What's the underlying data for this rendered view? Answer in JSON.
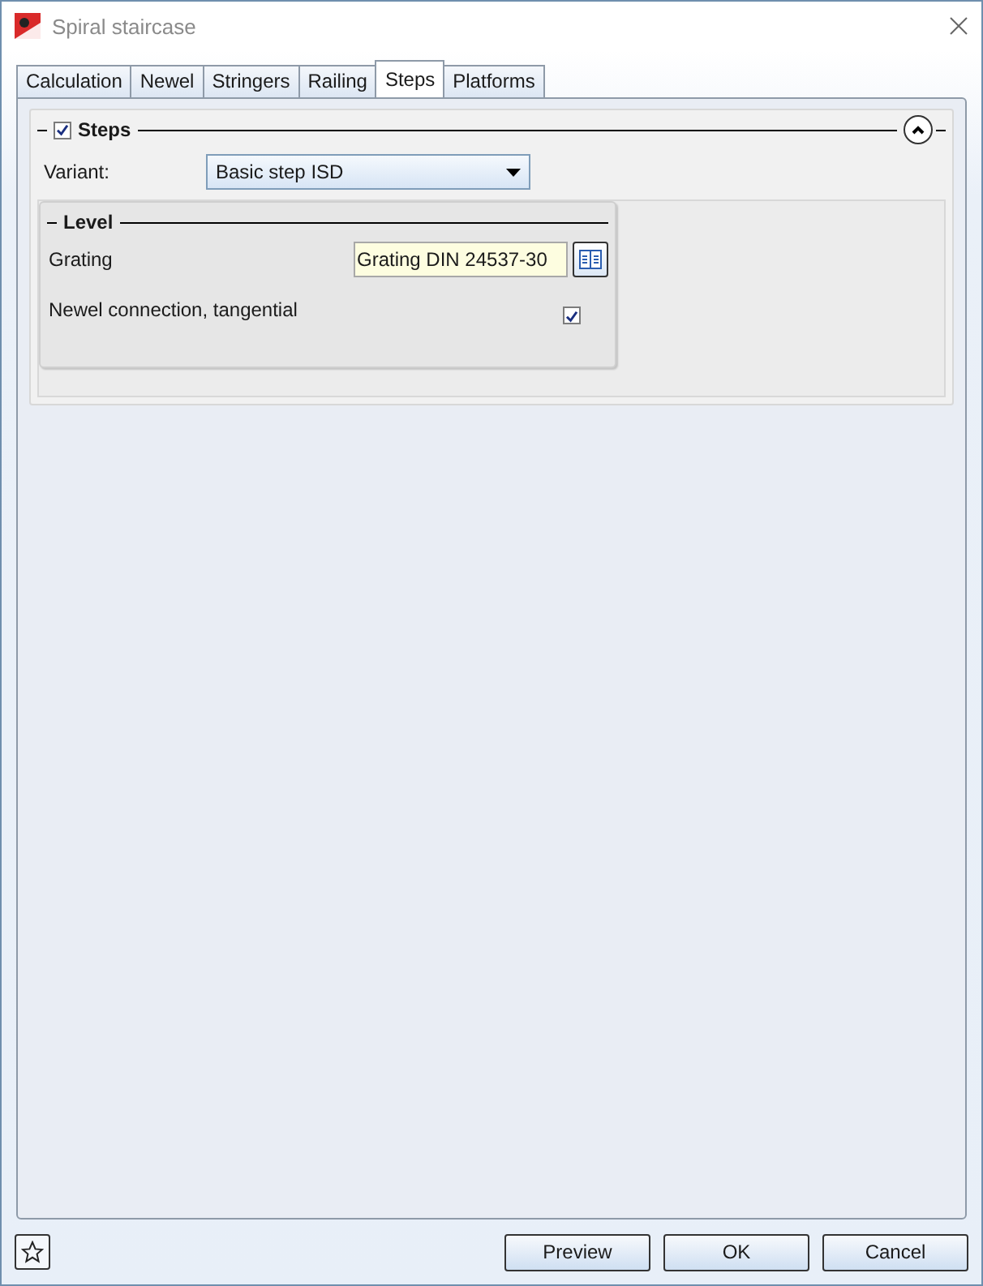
{
  "window": {
    "title": "Spiral staircase"
  },
  "tabs": [
    {
      "label": "Calculation",
      "selected": false
    },
    {
      "label": "Newel",
      "selected": false
    },
    {
      "label": "Stringers",
      "selected": false
    },
    {
      "label": "Railing",
      "selected": false
    },
    {
      "label": "Steps",
      "selected": true
    },
    {
      "label": "Platforms",
      "selected": false
    }
  ],
  "steps_group": {
    "title": "Steps",
    "checked": true,
    "expanded": true,
    "variant": {
      "label": "Variant:",
      "value": "Basic step ISD"
    },
    "level_group": {
      "title": "Level",
      "fields": [
        {
          "kind": "picker",
          "label": "Grating",
          "value": "Grating DIN 24537-30"
        },
        {
          "kind": "checkbox",
          "label": "Newel connection, tangential",
          "checked": true
        }
      ]
    }
  },
  "buttons": [
    "Preview",
    "OK",
    "Cancel"
  ]
}
